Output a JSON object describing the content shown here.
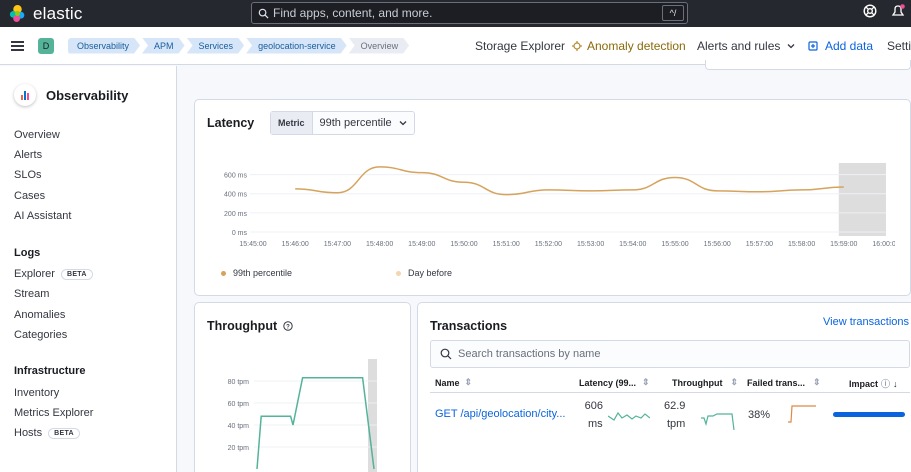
{
  "app": {
    "brand": "elastic",
    "search_placeholder": "Find apps, content, and more.",
    "search_shortcut": "^/"
  },
  "header": {
    "space_initial": "D",
    "breadcrumbs": [
      "Observability",
      "APM",
      "Services",
      "geolocation-service",
      "Overview"
    ],
    "links": {
      "storage_explorer": "Storage Explorer",
      "anomaly_detection": "Anomaly detection",
      "alerts_and_rules": "Alerts and rules",
      "add_data": "Add data",
      "settings_partial": "Setti"
    }
  },
  "sidebar": {
    "title": "Observability",
    "top_items": [
      "Overview",
      "Alerts",
      "SLOs",
      "Cases",
      "AI Assistant"
    ],
    "logs": {
      "heading": "Logs",
      "items": [
        {
          "label": "Explorer",
          "badge": "BETA"
        },
        {
          "label": "Stream",
          "badge": ""
        },
        {
          "label": "Anomalies",
          "badge": ""
        },
        {
          "label": "Categories",
          "badge": ""
        }
      ]
    },
    "infrastructure": {
      "heading": "Infrastructure",
      "items": [
        {
          "label": "Inventory",
          "badge": ""
        },
        {
          "label": "Metrics Explorer",
          "badge": ""
        },
        {
          "label": "Hosts",
          "badge": "BETA"
        }
      ]
    }
  },
  "latency": {
    "title": "Latency",
    "metric_prepend": "Metric",
    "metric_value": "99th percentile",
    "legend": [
      {
        "label": "99th percentile",
        "color": "#d6a35c"
      },
      {
        "label": "Day before",
        "color": "#f2d6ae"
      }
    ]
  },
  "throughput": {
    "title": "Throughput"
  },
  "transactions": {
    "title": "Transactions",
    "view_link": "View transactions",
    "search_placeholder": "Search transactions by name",
    "columns": [
      "Name",
      "Latency (99...",
      "Throughput",
      "Failed trans...",
      "Impact"
    ],
    "rows": [
      {
        "name": "GET /api/geolocation/city...",
        "latency": "606",
        "latency_unit": "ms",
        "throughput": "62.9",
        "throughput_unit": "tpm",
        "failed": "38%",
        "impact": 1.0
      }
    ]
  },
  "chart_data": [
    {
      "type": "line",
      "title": "Latency",
      "x": [
        "15:45:00",
        "15:46:00",
        "15:47:00",
        "15:48:00",
        "15:49:00",
        "15:50:00",
        "15:51:00",
        "15:52:00",
        "15:53:00",
        "15:54:00",
        "15:55:00",
        "15:56:00",
        "15:57:00",
        "15:58:00",
        "15:59:00",
        "16:00:00"
      ],
      "yticks": [
        "600 ms",
        "400 ms",
        "200 ms",
        "0 ms"
      ],
      "ylim": [
        0,
        700
      ],
      "series": [
        {
          "name": "99th percentile",
          "color": "#d6a35c",
          "points": [
            [
              "15:46:00",
              450
            ],
            [
              "15:47:00",
              410
            ],
            [
              "15:48:00",
              680
            ],
            [
              "15:49:00",
              620
            ],
            [
              "15:50:00",
              520
            ],
            [
              "15:51:00",
              390
            ],
            [
              "15:52:00",
              440
            ],
            [
              "15:53:00",
              430
            ],
            [
              "15:54:00",
              440
            ],
            [
              "15:55:00",
              570
            ],
            [
              "15:56:00",
              430
            ],
            [
              "15:57:00",
              420
            ],
            [
              "15:58:00",
              440
            ],
            [
              "15:59:00",
              470
            ]
          ]
        }
      ]
    },
    {
      "type": "line",
      "title": "Throughput",
      "yticks": [
        "80 tpm",
        "60 tpm",
        "40 tpm",
        "20 tpm"
      ],
      "ylim": [
        0,
        100
      ],
      "series": [
        {
          "name": "",
          "color": "#54b399",
          "points": [
            [
              0,
              0
            ],
            [
              1,
              48
            ],
            [
              2,
              48
            ],
            [
              3,
              40
            ],
            [
              4,
              83
            ],
            [
              5,
              83
            ],
            [
              6,
              83
            ],
            [
              7,
              0
            ]
          ]
        }
      ]
    }
  ]
}
